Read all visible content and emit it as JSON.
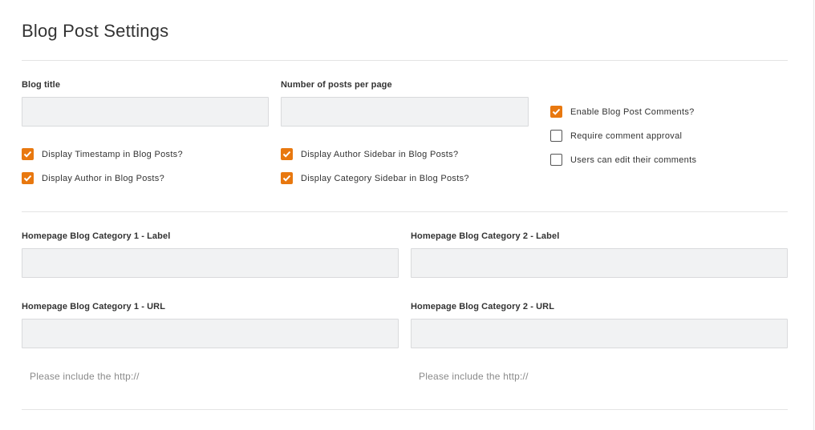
{
  "page": {
    "title": "Blog Post Settings"
  },
  "general": {
    "blog_title": {
      "label": "Blog title",
      "value": "",
      "placeholder": ""
    },
    "posts_per_page": {
      "label": "Number of posts per page",
      "value": "",
      "placeholder": ""
    },
    "checkboxes": {
      "display_timestamp": {
        "label": "Display Timestamp in Blog Posts?",
        "checked": true
      },
      "display_author": {
        "label": "Display Author in Blog Posts?",
        "checked": true
      },
      "display_author_sidebar": {
        "label": "Display Author Sidebar in Blog Posts?",
        "checked": true
      },
      "display_category_sidebar": {
        "label": "Display Category Sidebar in Blog Posts?",
        "checked": true
      },
      "enable_comments": {
        "label": "Enable Blog Post Comments?",
        "checked": true
      },
      "require_approval": {
        "label": "Require comment approval",
        "checked": false
      },
      "users_edit": {
        "label": "Users can edit their comments",
        "checked": false
      }
    }
  },
  "homepage": {
    "cat1_label": {
      "label": "Homepage Blog Category 1 - Label",
      "value": ""
    },
    "cat2_label": {
      "label": "Homepage Blog Category 2 - Label",
      "value": ""
    },
    "cat1_url": {
      "label": "Homepage Blog Category 1 - URL",
      "value": ""
    },
    "cat2_url": {
      "label": "Homepage Blog Category 2 - URL",
      "value": ""
    },
    "url_hint_1": "Please include the http://",
    "url_hint_2": "Please include the http://"
  },
  "colors": {
    "accent": "#e8780f",
    "input_bg": "#f1f2f3",
    "divider": "#e4e4e4"
  },
  "icons": {
    "checkbox_checked": "checkmark-icon"
  }
}
